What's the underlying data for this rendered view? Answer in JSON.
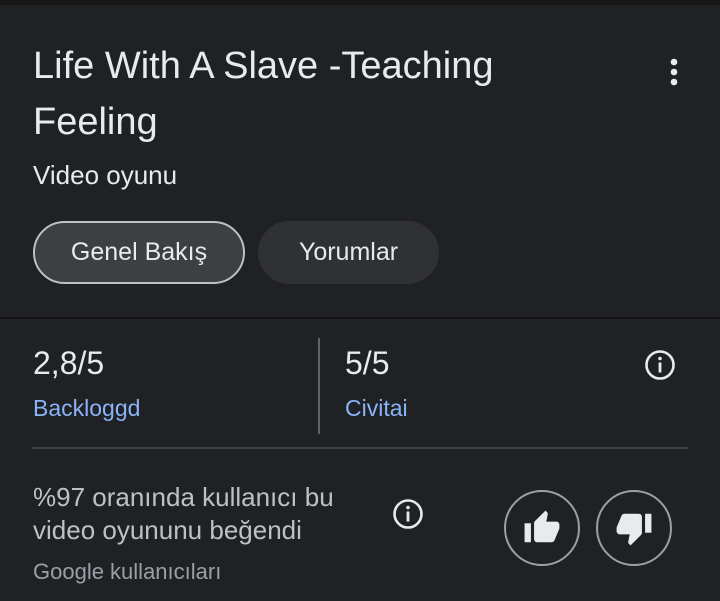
{
  "header": {
    "title": "Life With A Slave -Teaching Feeling",
    "subtitle": "Video oyunu",
    "menu_icon": "more-vert-icon"
  },
  "tabs": [
    {
      "label": "Genel Bakış",
      "selected": true
    },
    {
      "label": "Yorumlar",
      "selected": false
    }
  ],
  "ratings": [
    {
      "value": "2,8/5",
      "source": "Backloggd"
    },
    {
      "value": "5/5",
      "source": "Civitai"
    }
  ],
  "user_rating": {
    "text": "%97 oranında kullanıcı bu video oyununu beğendi",
    "source": "Google kullanıcıları"
  },
  "colors": {
    "background": "#202124",
    "text": "#e8eaed",
    "link": "#8ab4f8",
    "chip_selected": "#3c4043",
    "chip": "#303134"
  }
}
